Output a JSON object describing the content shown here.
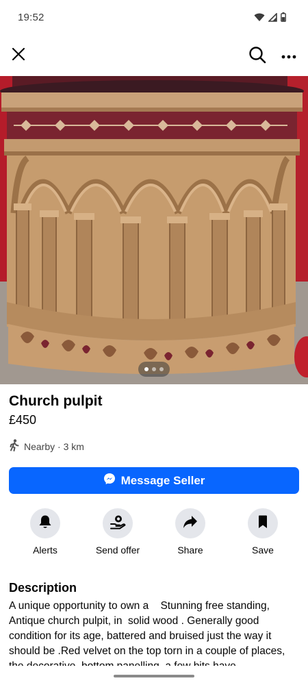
{
  "status_bar": {
    "time": "19:52",
    "icons": [
      "wifi-icon",
      "signal-icon",
      "battery-icon"
    ]
  },
  "top_bar": {
    "icons": [
      "close-icon",
      "search-icon",
      "more-icon"
    ]
  },
  "photo": {
    "description": "",
    "pager_dots": 3,
    "active_dot": 1
  },
  "listing": {
    "title": "Church pulpit",
    "price": "£450",
    "location": "Nearby · 3 km"
  },
  "primary_action": {
    "label": "Message Seller",
    "icon": "messenger-icon",
    "color": "#0866ff"
  },
  "actions": [
    {
      "label": "Alerts",
      "icon": "bell-icon"
    },
    {
      "label": "Send offer",
      "icon": "offer-icon"
    },
    {
      "label": "Share",
      "icon": "share-icon"
    },
    {
      "label": "Save",
      "icon": "bookmark-icon"
    }
  ],
  "description": {
    "heading": "Description",
    "text": "A unique opportunity to own a    Stunning free standing, Antique church pulpit, in  solid wood . Generally good condition for its age, battered and bruised just the way it should be .Red velvet on the top torn in a couple of places, the decorative  bottom panelling, a few bits have"
  }
}
